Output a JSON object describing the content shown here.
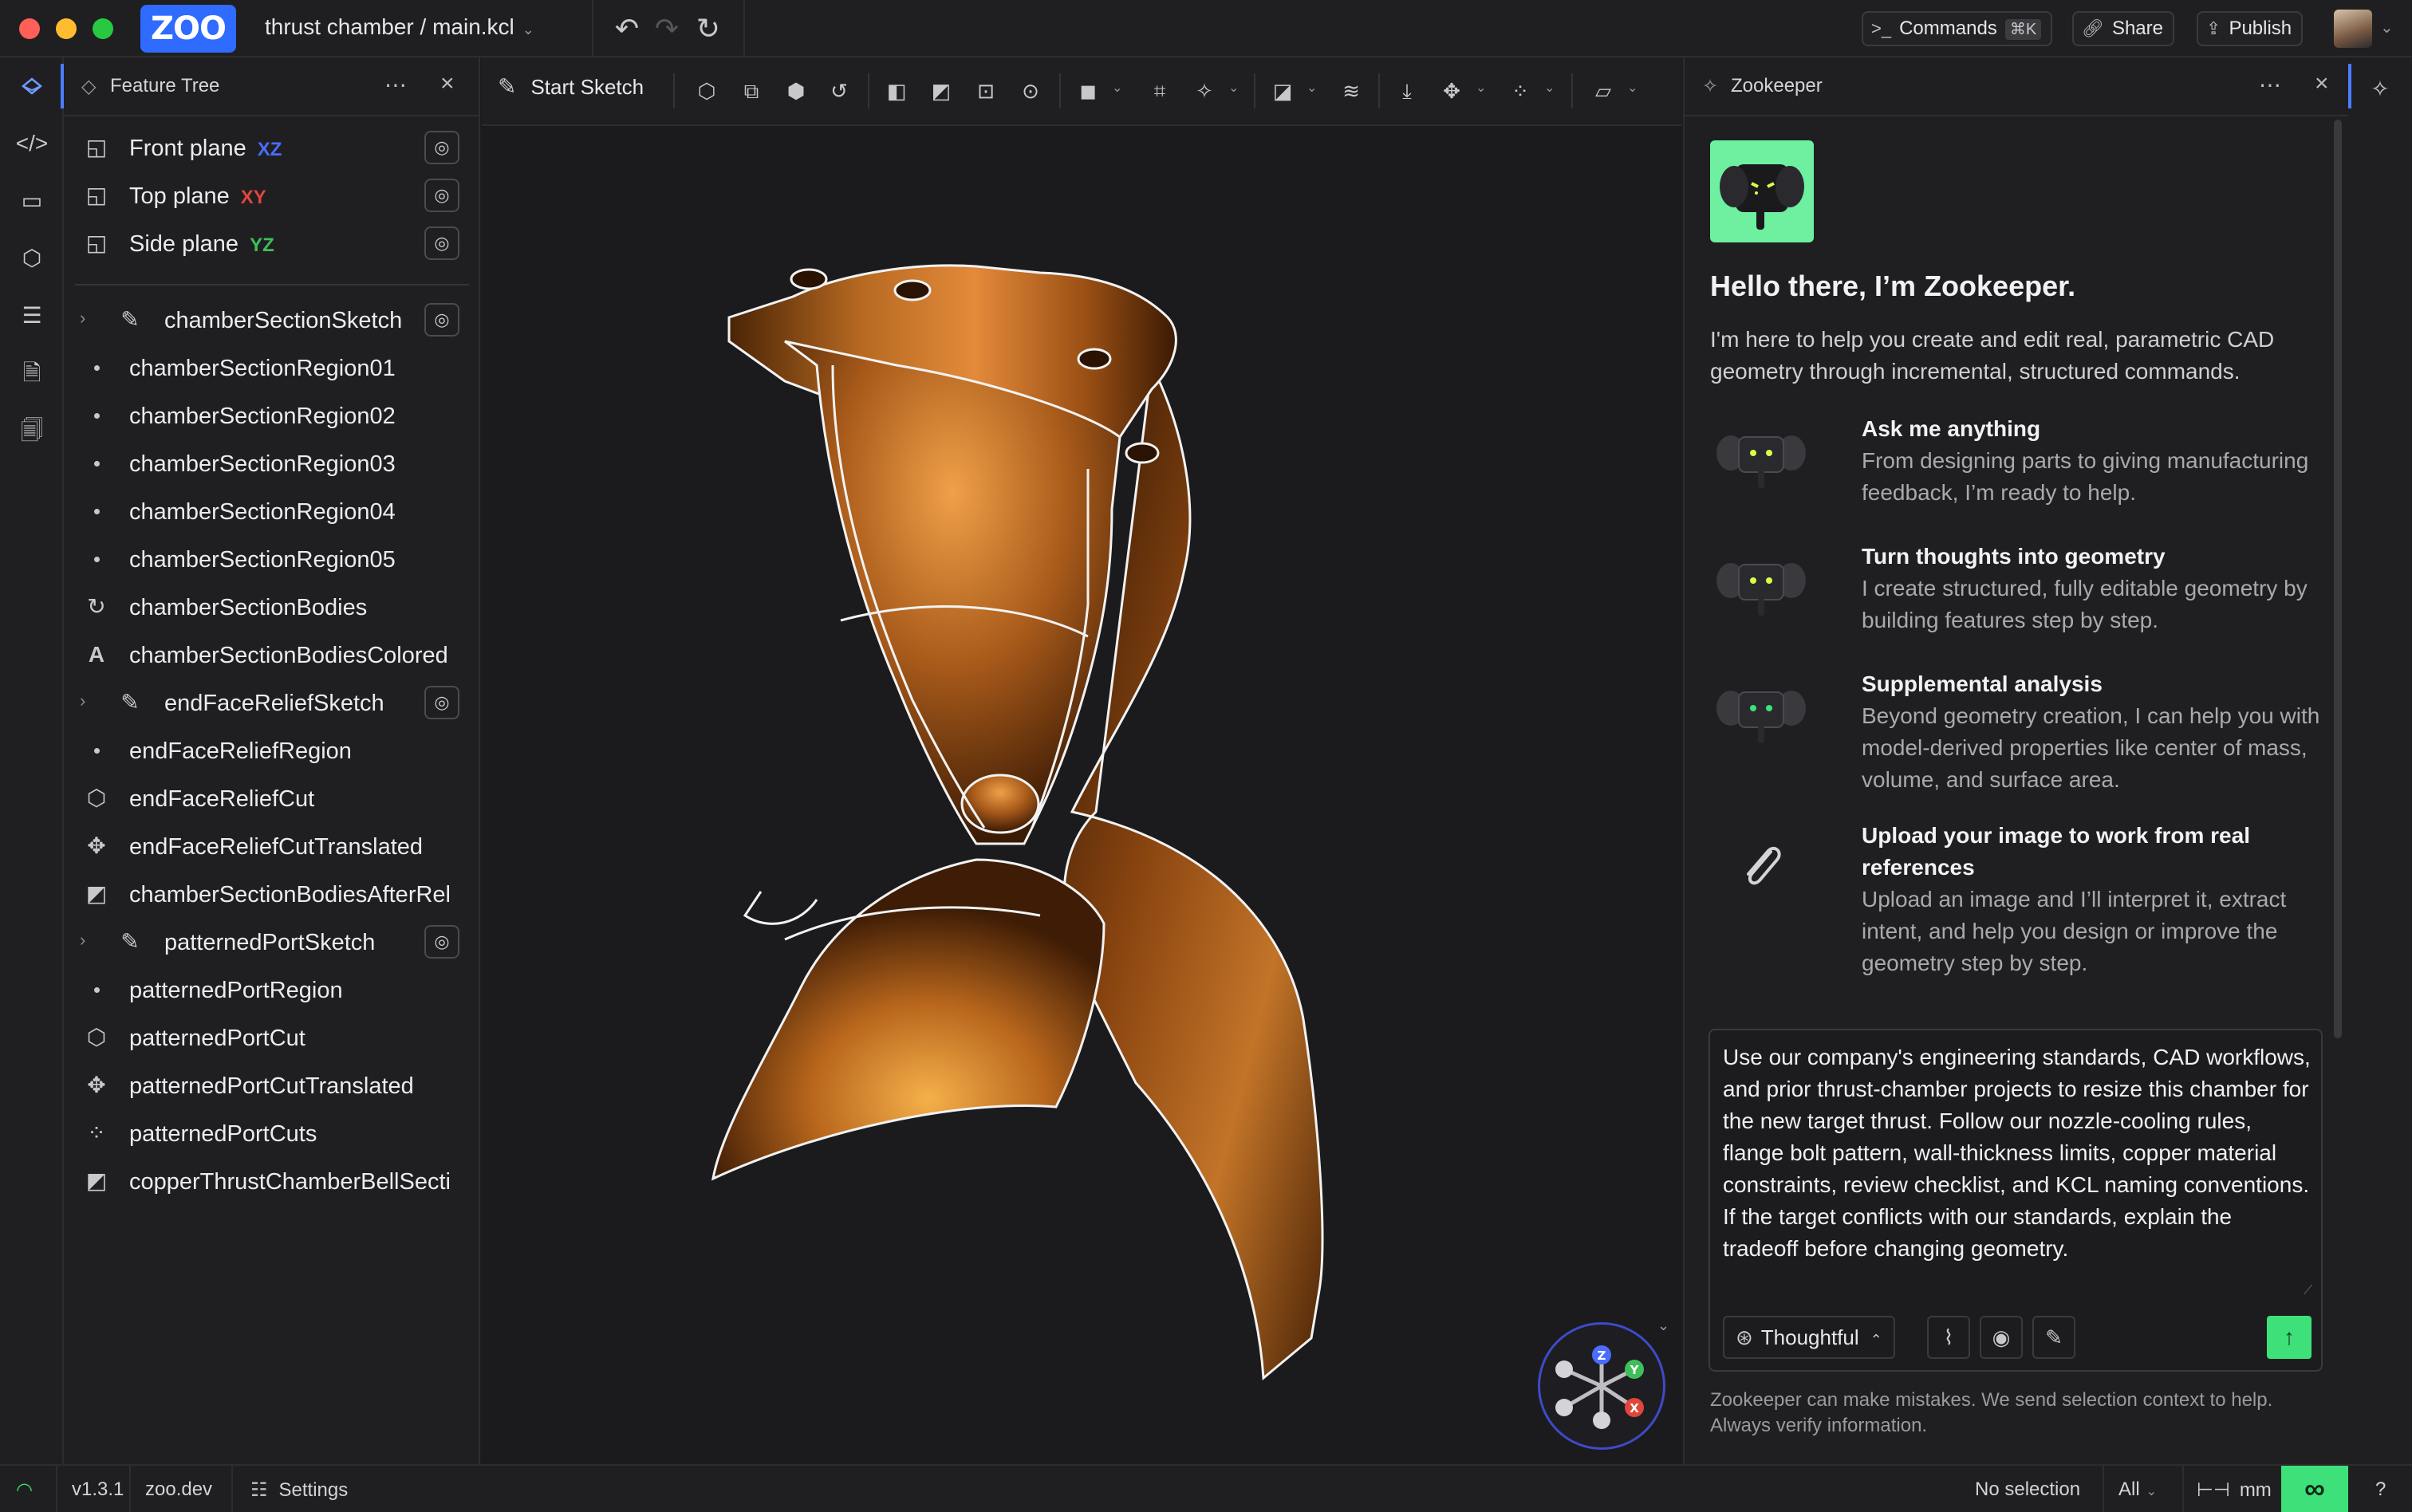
{
  "titlebar": {
    "logo_text": "ZOO",
    "filename": "thrust chamber / main.kcl",
    "commands_label": "Commands",
    "commands_shortcut": "⌘K",
    "share_label": "Share",
    "publish_label": "Publish"
  },
  "feature_tree": {
    "title": "Feature Tree",
    "planes": [
      {
        "label": "Front plane",
        "axis": "XZ",
        "axis_color": "#4a6cff"
      },
      {
        "label": "Top plane",
        "axis": "XY",
        "axis_color": "#e0463a"
      },
      {
        "label": "Side plane",
        "axis": "YZ",
        "axis_color": "#3fbf5a"
      }
    ],
    "items": [
      {
        "label": "chamberSectionSketch",
        "icon": "sketch-icon"
      },
      {
        "label": "chamberSectionRegion01",
        "icon": "region-dot-icon"
      },
      {
        "label": "chamberSectionRegion02",
        "icon": "region-dot-icon"
      },
      {
        "label": "chamberSectionRegion03",
        "icon": "region-dot-icon"
      },
      {
        "label": "chamberSectionRegion04",
        "icon": "region-dot-icon"
      },
      {
        "label": "chamberSectionRegion05",
        "icon": "region-dot-icon"
      },
      {
        "label": "chamberSectionBodies",
        "icon": "revolve-icon"
      },
      {
        "label": "chamberSectionBodiesColored",
        "icon": "appearance-icon"
      },
      {
        "label": "endFaceReliefSketch",
        "icon": "sketch-icon"
      },
      {
        "label": "endFaceReliefRegion",
        "icon": "region-dot-icon"
      },
      {
        "label": "endFaceReliefCut",
        "icon": "extrude-cube-icon"
      },
      {
        "label": "endFaceReliefCutTranslated",
        "icon": "translate-icon"
      },
      {
        "label": "chamberSectionBodiesAfterRel",
        "icon": "boolean-icon"
      },
      {
        "label": "patternedPortSketch",
        "icon": "sketch-icon"
      },
      {
        "label": "patternedPortRegion",
        "icon": "region-dot-icon"
      },
      {
        "label": "patternedPortCut",
        "icon": "extrude-cube-icon"
      },
      {
        "label": "patternedPortCutTranslated",
        "icon": "translate-icon"
      },
      {
        "label": "patternedPortCuts",
        "icon": "pattern-icon"
      },
      {
        "label": "copperThrustChamberBellSecti",
        "icon": "boolean-icon"
      }
    ]
  },
  "toolbar": {
    "start_sketch_label": "Start Sketch"
  },
  "zookeeper": {
    "title": "Zookeeper",
    "greeting": "Hello there, I’m Zookeeper.",
    "intro": "I'm here to help you create and edit real, parametric CAD geometry through incremental, structured commands.",
    "features": [
      {
        "title": "Ask me anything",
        "body": "From designing parts to giving manufacturing feedback, I’m ready to help."
      },
      {
        "title": "Turn thoughts into geometry",
        "body": "I create structured, fully editable geometry by building features step by step."
      },
      {
        "title": "Supplemental analysis",
        "body": "Beyond geometry creation, I can help you with model-derived properties like center of mass, volume, and surface area."
      },
      {
        "title": "Upload your image to work from real references",
        "body": "Upload an image and I’ll interpret it, extract intent, and help you design or improve the geometry step by step."
      }
    ],
    "prompt": "Use our company's engineering standards, CAD workflows, and prior thrust-chamber projects to resize this chamber for the new target thrust. Follow our nozzle-cooling rules, flange bolt pattern, wall-thickness limits, copper material constraints, review checklist, and KCL naming conventions. If the target conflicts with our standards, explain the tradeoff before changing geometry.",
    "mode_label": "Thoughtful",
    "disclaimer": "Zookeeper can make mistakes. We send selection context to help. Always verify information."
  },
  "gizmo": {
    "z": "Z",
    "y": "Y",
    "x": "X"
  },
  "statusbar": {
    "version": "v1.3.1",
    "site": "zoo.dev",
    "settings_label": "Settings",
    "selection": "No selection",
    "filter": "All",
    "units": "mm"
  }
}
